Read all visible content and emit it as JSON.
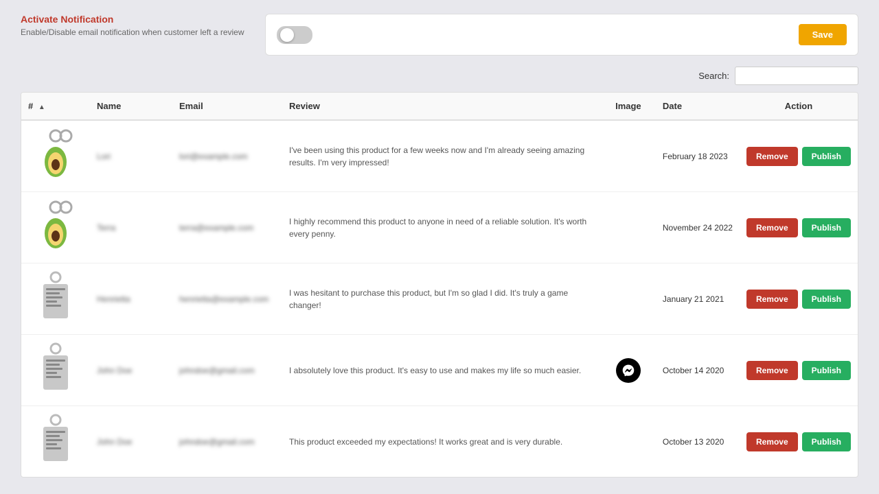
{
  "header": {
    "activate_label": "Activate Notification",
    "activate_desc": "Enable/Disable email notification when customer left a review",
    "save_label": "Save",
    "search_label": "Search:",
    "search_placeholder": ""
  },
  "table": {
    "columns": [
      "#",
      "Name",
      "Email",
      "Review",
      "Image",
      "Date",
      "Action"
    ],
    "remove_label": "Remove",
    "publish_label": "Publish",
    "rows": [
      {
        "id": 1,
        "name": "Lori",
        "email": "lori@example.com",
        "review": "I've been using this product for a few weeks now and I'm already seeing amazing results. I'm very impressed!",
        "image_type": "avocado",
        "date": "February 18 2023",
        "has_messenger": false
      },
      {
        "id": 2,
        "name": "Terra",
        "email": "terra@example.com",
        "review": "I highly recommend this product to anyone in need of a reliable solution. It's worth every penny.",
        "image_type": "avocado",
        "date": "November 24 2022",
        "has_messenger": false
      },
      {
        "id": 3,
        "name": "Henrietta",
        "email": "henrietta@example.com",
        "review": "I was hesitant to purchase this product, but I'm so glad I did. It's truly a game changer!",
        "image_type": "tag",
        "date": "January 21 2021",
        "has_messenger": false
      },
      {
        "id": 4,
        "name": "John Doe",
        "email": "johndoe@gmail.com",
        "review": "I absolutely love this product. It's easy to use and makes my life so much easier.",
        "image_type": "tag",
        "date": "October 14 2020",
        "has_messenger": true
      },
      {
        "id": 5,
        "name": "John Doe",
        "email": "johndoe@gmail.com",
        "review": "This product exceeded my expectations! It works great and is very durable.",
        "image_type": "tag",
        "date": "October 13 2020",
        "has_messenger": false
      }
    ]
  }
}
